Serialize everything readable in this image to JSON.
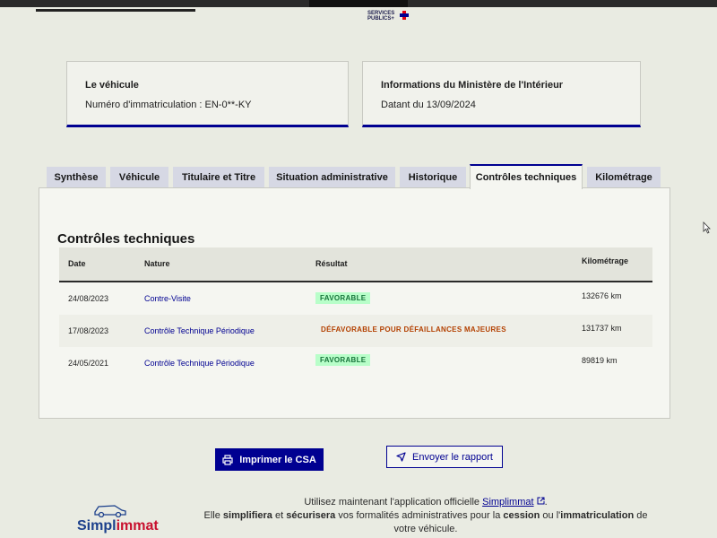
{
  "header": {
    "logo_line1": "SERVICES",
    "logo_line2": "PUBLICS+"
  },
  "vehicle_card": {
    "title": "Le véhicule",
    "plate_label": "Numéro d'immatriculation : EN-0**-KY"
  },
  "ministry_card": {
    "title": "Informations du Ministère de l'Intérieur",
    "date_label": "Datant du 13/09/2024"
  },
  "tabs": [
    {
      "label": "Synthèse",
      "active": false
    },
    {
      "label": "Véhicule",
      "active": false
    },
    {
      "label": "Titulaire et Titre",
      "active": false
    },
    {
      "label": "Situation administrative",
      "active": false
    },
    {
      "label": "Historique",
      "active": false
    },
    {
      "label": "Contrôles techniques",
      "active": true
    },
    {
      "label": "Kilométrage",
      "active": false
    }
  ],
  "section": {
    "title": "Contrôles techniques",
    "columns": [
      "Date",
      "Nature",
      "Résultat",
      "Kilométrage"
    ],
    "rows": [
      {
        "date": "24/08/2023",
        "nature": "Contre-Visite",
        "result": "FAVORABLE",
        "status": "ok",
        "km": "132676 km"
      },
      {
        "date": "17/08/2023",
        "nature": "Contrôle Technique Périodique",
        "result": "DÉFAVORABLE POUR DÉFAILLANCES MAJEURES",
        "status": "ko",
        "km": "131737 km"
      },
      {
        "date": "24/05/2021",
        "nature": "Contrôle Technique Périodique",
        "result": "FAVORABLE",
        "status": "ok",
        "km": "89819 km"
      }
    ]
  },
  "actions": {
    "print_label": "Imprimer le CSA",
    "send_label": "Envoyer le rapport"
  },
  "footer": {
    "line1_prefix": "Utilisez maintenant l'application officielle",
    "link_label": "Simplimmat",
    "line1_suffix": ".",
    "line2_a": "Elle",
    "simplify": "simplifiera",
    "line2_b": "et",
    "secure": "sécurisera",
    "line2_c": "vos formalités administratives pour la",
    "cession": "cession",
    "line2_d": "ou l'",
    "immat": "immatriculation",
    "line2_e": "de",
    "line3": "votre véhicule.",
    "brand_a": "Simpl",
    "brand_b": "immat"
  },
  "colors": {
    "primary": "#000091",
    "success_bg": "#b8fec9",
    "success_text": "#18753c",
    "error_text": "#b34000"
  }
}
